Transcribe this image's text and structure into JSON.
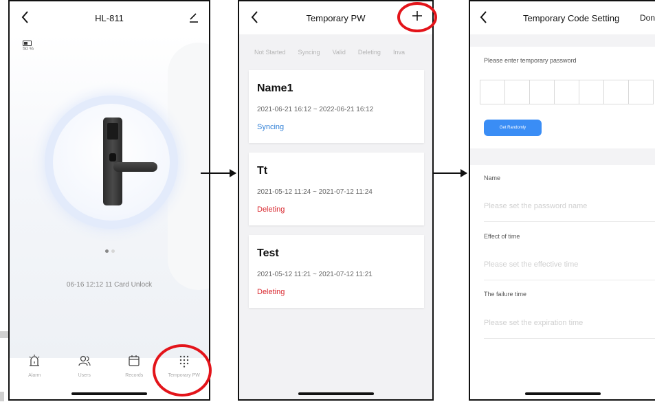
{
  "screen1": {
    "title": "HL-811",
    "battery_text": "50 %",
    "status_line": "06-16 12:12  11 Card Unlock",
    "tabs": [
      {
        "label": "Alarm",
        "icon": "alarm-icon"
      },
      {
        "label": "Users",
        "icon": "users-icon"
      },
      {
        "label": "Records",
        "icon": "calendar-icon"
      },
      {
        "label": "Temporary PW",
        "icon": "keypad-icon"
      }
    ]
  },
  "screen2": {
    "title": "Temporary PW",
    "filters": [
      "Not Started",
      "Syncing",
      "Valid",
      "Deleting",
      "Inva"
    ],
    "items": [
      {
        "name": "Name1",
        "time": "2021-06-21 16:12 ~ 2022-06-21 16:12",
        "status": "Syncing",
        "status_color": "#2f7fd6"
      },
      {
        "name": "Tt",
        "time": "2021-05-12 11:24 ~ 2021-07-12 11:24",
        "status": "Deleting",
        "status_color": "#d9282f"
      },
      {
        "name": "Test",
        "time": "2021-05-12 11:21 ~ 2021-07-12 11:21",
        "status": "Deleting",
        "status_color": "#d9282f"
      }
    ]
  },
  "screen3": {
    "title": "Temporary Code Setting",
    "done_label": "Don",
    "password_prompt": "Please enter temporary password",
    "random_button": "Get Randomly",
    "name_label": "Name",
    "name_placeholder": "Please set the password name",
    "effect_label": "Effect of time",
    "effect_placeholder": "Please set the effective time",
    "failure_label": "The failure time",
    "failure_placeholder": "Please set the expiration time"
  },
  "colors": {
    "highlight_circle": "#e3141a",
    "accent_blue": "#3a8df5"
  }
}
